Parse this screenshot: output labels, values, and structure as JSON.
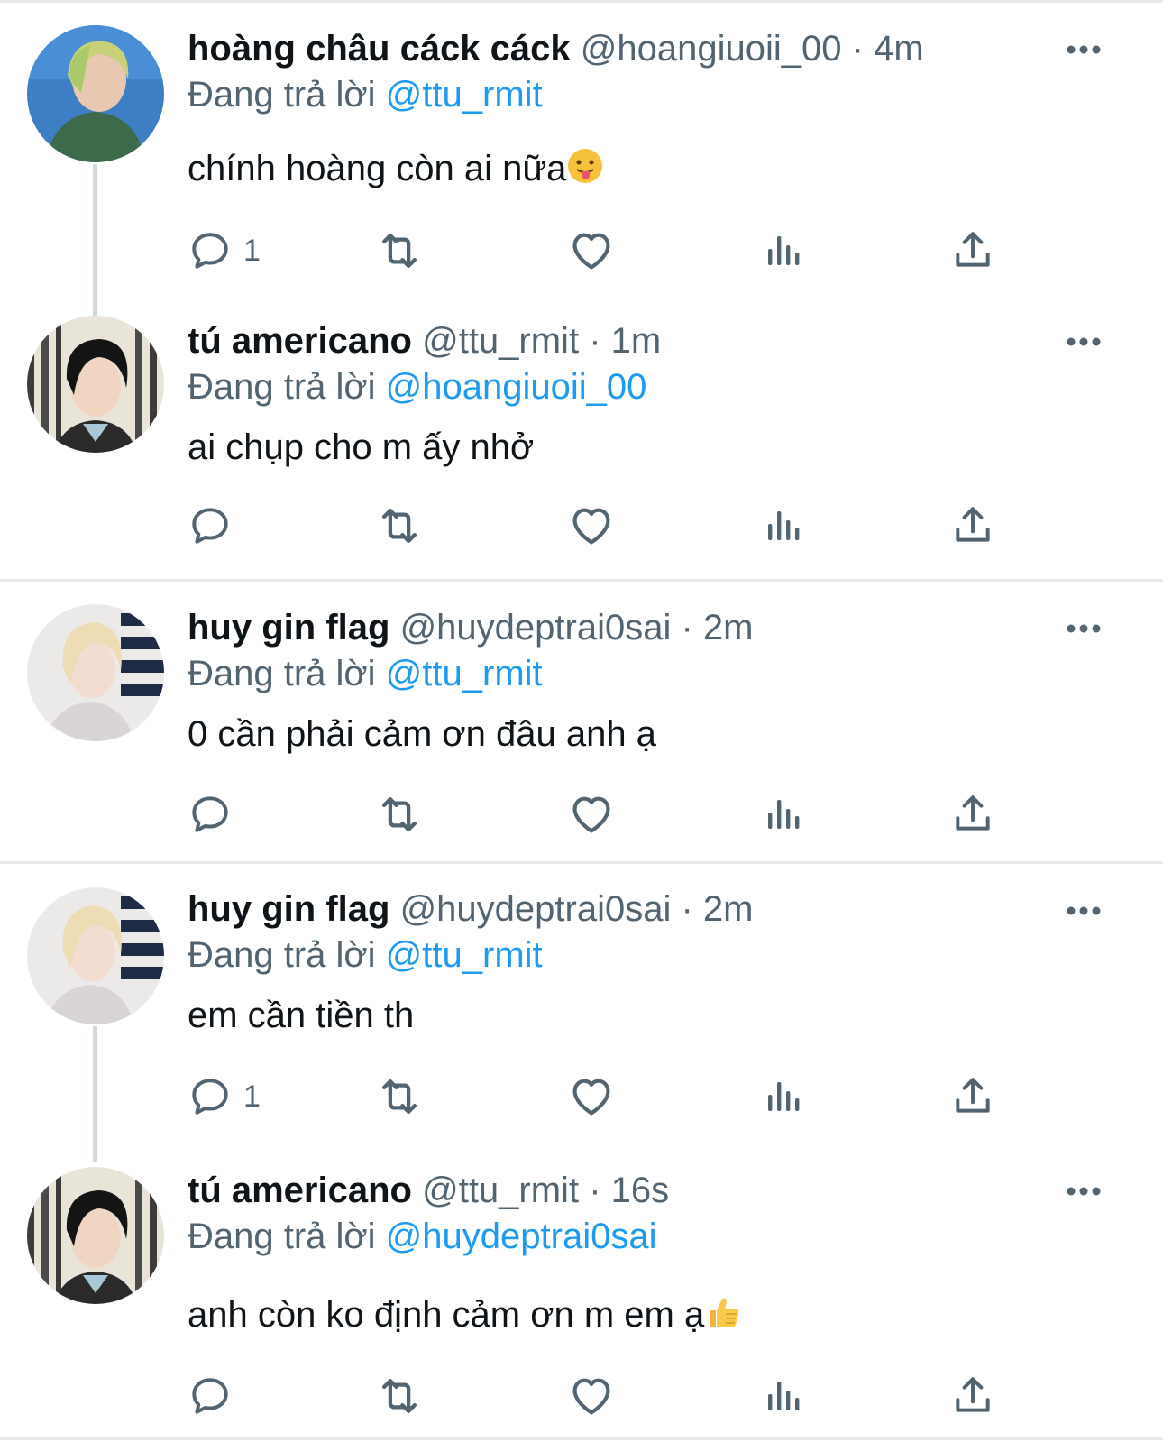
{
  "labels": {
    "replying_prefix": "Đang trả lời"
  },
  "colors": {
    "mention": "#1d9bf0",
    "secondary": "#536471",
    "primary": "#0f1419",
    "divider": "#e6e8ea",
    "thread_line": "#cfd9de"
  },
  "tweets": [
    {
      "name": "hoàng châu cáck cáck",
      "handle": "@hoangiuoii_00",
      "sep": "·",
      "time": "4m",
      "reply_to": "@ttu_rmit",
      "text": "chính hoàng còn ai nữa",
      "emoji": "tongue-out-face-emoji",
      "reply_count": "1"
    },
    {
      "name": "tú americano",
      "handle": "@ttu_rmit",
      "sep": "·",
      "time": "1m",
      "reply_to": "@hoangiuoii_00",
      "text": "ai chụp cho m ấy nhở",
      "reply_count": ""
    },
    {
      "name": "huy gin flag",
      "handle": "@huydeptrai0sai",
      "sep": "·",
      "time": "2m",
      "reply_to": "@ttu_rmit",
      "text": "0 cần phải cảm ơn đâu anh ạ",
      "reply_count": ""
    },
    {
      "name": "huy gin flag",
      "handle": "@huydeptrai0sai",
      "sep": "·",
      "time": "2m",
      "reply_to": "@ttu_rmit",
      "text": "em cần tiền th",
      "reply_count": "1"
    },
    {
      "name": "tú americano",
      "handle": "@ttu_rmit",
      "sep": "·",
      "time": "16s",
      "reply_to": "@huydeptrai0sai",
      "text": "anh còn ko định cảm ơn m em ạ",
      "emoji": "thumbs-up-emoji",
      "reply_count": ""
    }
  ]
}
